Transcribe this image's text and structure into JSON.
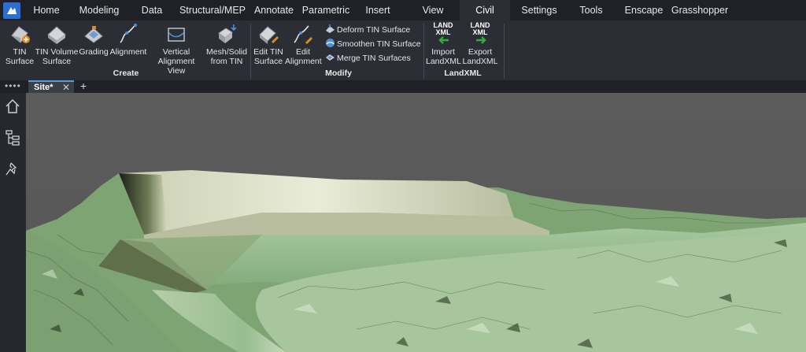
{
  "tabs": [
    {
      "label": "Home",
      "active": false
    },
    {
      "label": "Modeling",
      "active": false
    },
    {
      "label": "Data",
      "active": false
    },
    {
      "label": "Structural/MEP",
      "active": false
    },
    {
      "label": "Annotate",
      "active": false
    },
    {
      "label": "Parametric",
      "active": false
    },
    {
      "label": "Insert",
      "active": false
    },
    {
      "label": "View",
      "active": false
    },
    {
      "label": "Civil",
      "active": true
    },
    {
      "label": "Settings",
      "active": false
    },
    {
      "label": "Tools",
      "active": false
    },
    {
      "label": "Enscape",
      "active": false
    },
    {
      "label": "Grasshopper",
      "active": false
    }
  ],
  "ribbon": {
    "create": {
      "title": "Create",
      "buttons": [
        {
          "label": "TIN\nSurface",
          "icon": "tin-surface-icon"
        },
        {
          "label": "TIN Volume\nSurface",
          "icon": "tin-volume-surface-icon"
        },
        {
          "label": "Grading",
          "icon": "grading-icon"
        },
        {
          "label": "Alignment",
          "icon": "alignment-icon"
        },
        {
          "label": "Vertical\nAlignment View",
          "icon": "vertical-alignment-view-icon"
        },
        {
          "label": "Mesh/Solid\nfrom TIN",
          "icon": "mesh-solid-from-tin-icon"
        }
      ]
    },
    "modify": {
      "title": "Modify",
      "buttons": [
        {
          "label": "Edit TIN\nSurface",
          "icon": "edit-tin-surface-icon"
        },
        {
          "label": "Edit\nAlignment",
          "icon": "edit-alignment-icon"
        }
      ],
      "small_buttons": [
        {
          "label": "Deform TIN Surface",
          "icon": "deform-tin-surface-icon"
        },
        {
          "label": "Smoothen TIN Surface",
          "icon": "smoothen-tin-surface-icon"
        },
        {
          "label": "Merge TIN Surfaces",
          "icon": "merge-tin-surfaces-icon"
        }
      ]
    },
    "landxml": {
      "title": "LandXML",
      "icon_text": "LAND\nXML",
      "buttons": [
        {
          "label": "Import\nLandXML",
          "icon": "import-landxml-icon"
        },
        {
          "label": "Export\nLandXML",
          "icon": "export-landxml-icon"
        }
      ]
    }
  },
  "document": {
    "tab_label": "Site*",
    "close_glyph": "✕",
    "new_tab_glyph": "+",
    "overflow_glyph": "••••"
  },
  "sidebar": {
    "icons": [
      "home-icon",
      "structure-tree-icon",
      "pin-icon"
    ]
  },
  "colors": {
    "accent": "#2d6fd0",
    "active_tab_bg": "#2b2e35",
    "tabbar_bg": "#1f2126",
    "viewport_bg": "#5a5a5a",
    "terrain": "#8fb88a"
  }
}
